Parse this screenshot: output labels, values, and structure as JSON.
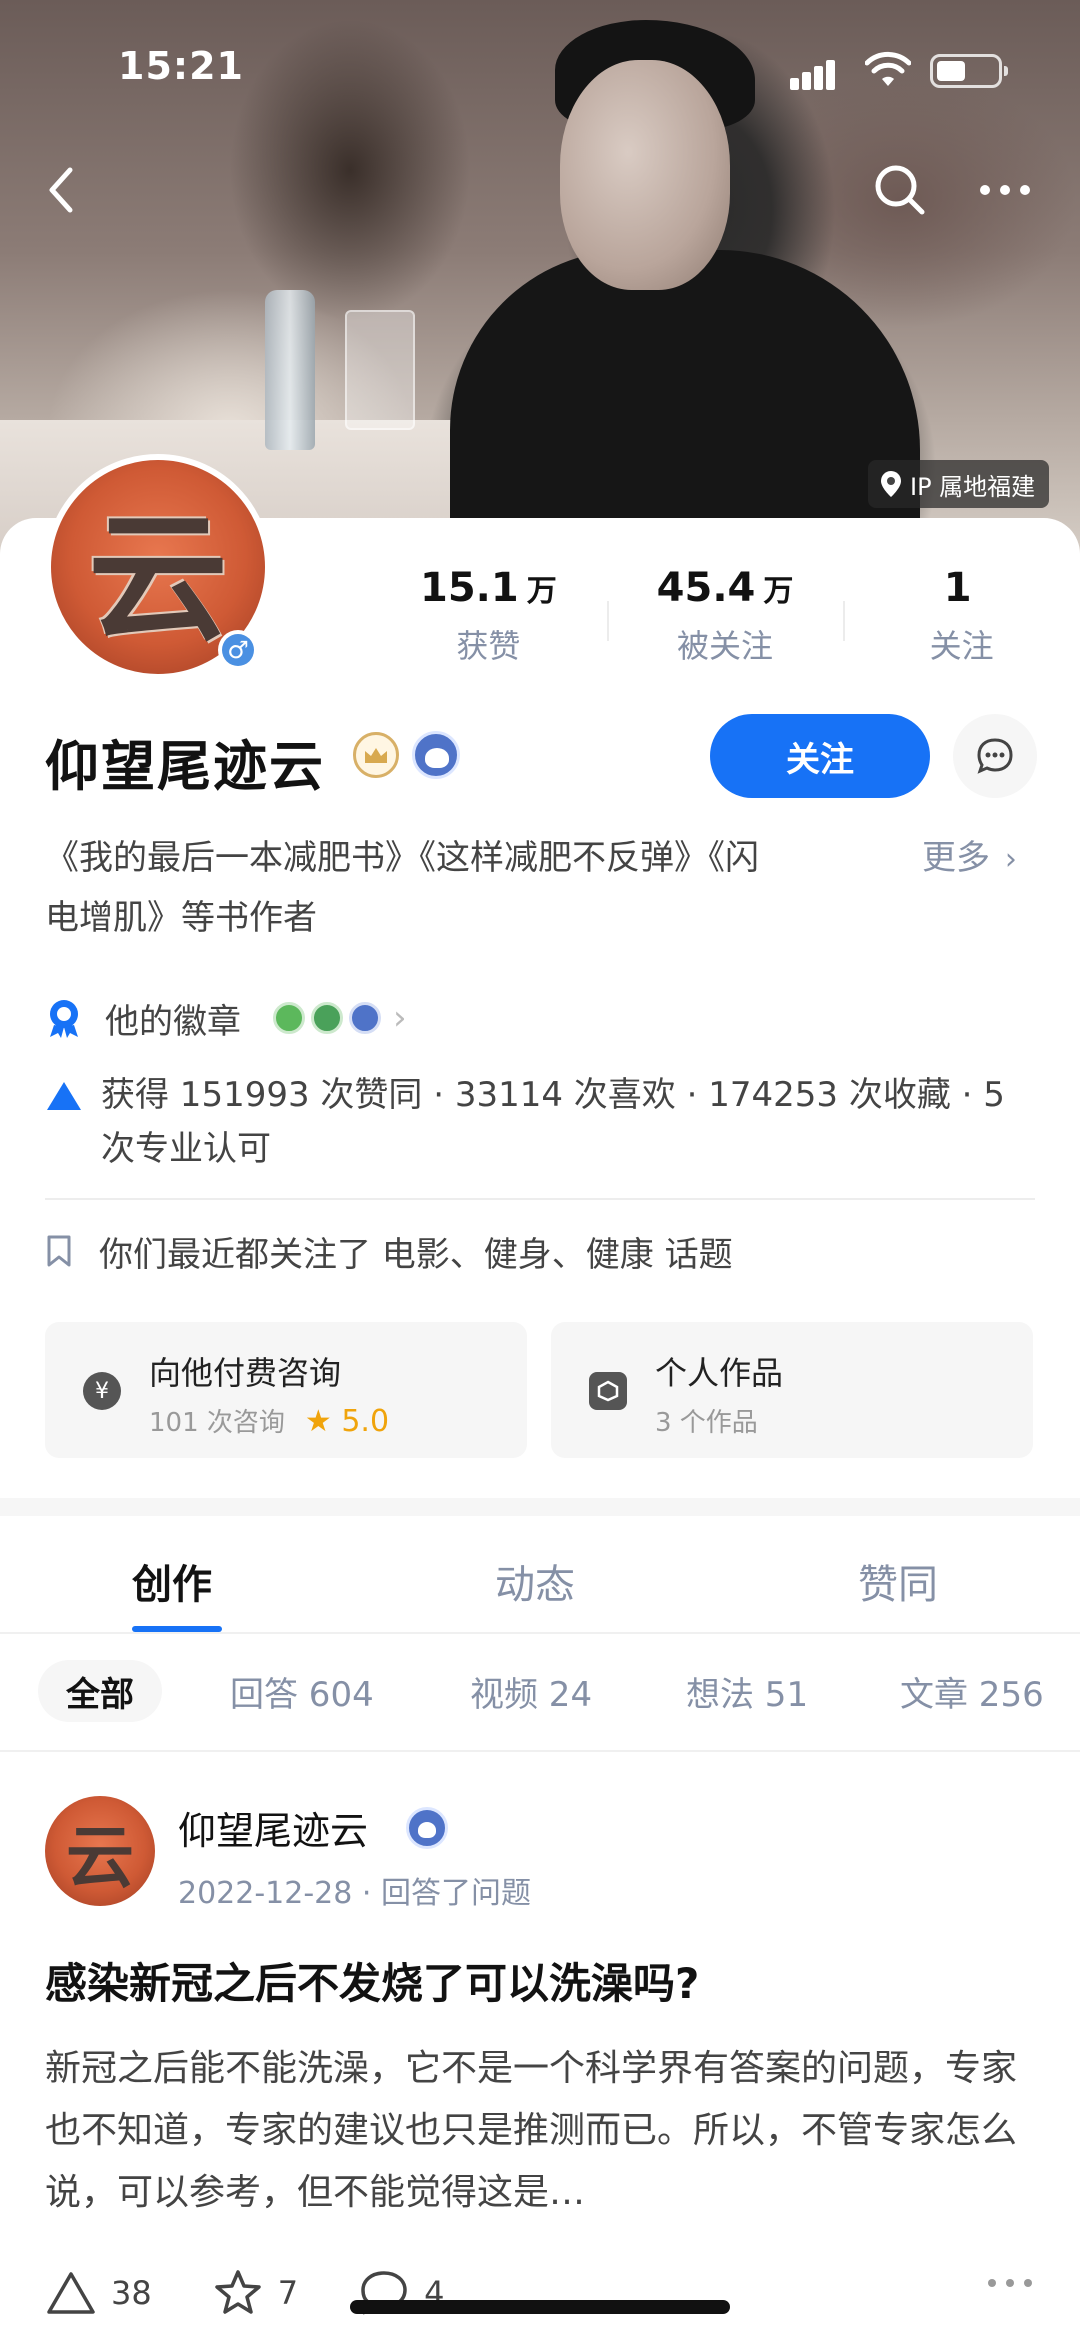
{
  "status_bar": {
    "time": "15:21"
  },
  "cover": {
    "ip_location": "IP 属地福建"
  },
  "profile": {
    "name": "仰望尾迹云",
    "avatar_glyph": "云",
    "gender_symbol": "♂",
    "stats": [
      {
        "value": "15.1",
        "unit": "万",
        "label": "获赞"
      },
      {
        "value": "45.4",
        "unit": "万",
        "label": "被关注"
      },
      {
        "value": "1",
        "unit": "",
        "label": "关注"
      }
    ],
    "follow_label": "关注",
    "bio": "《我的最后一本减肥书》《这样减肥不反弹》《闪电增肌》等书作者",
    "bio_more": "更多",
    "badges_label": "他的徽章",
    "achievements": "获得 151993 次赞同 · 33114 次喜欢 · 174253 次收藏 · 5 次专业认可",
    "common_topics": "你们最近都关注了 电影、健身、健康 话题"
  },
  "services": [
    {
      "title": "向他付费咨询",
      "sub": "101 次咨询",
      "rating": "★ 5.0",
      "icon": "yuan-icon"
    },
    {
      "title": "个人作品",
      "sub": "3 个作品",
      "rating": "",
      "icon": "works-icon"
    }
  ],
  "tabs": [
    "创作",
    "动态",
    "赞同"
  ],
  "filters": [
    "全部",
    "回答 604",
    "视频 24",
    "想法 51",
    "文章 256"
  ],
  "post": {
    "author": "仰望尾迹云",
    "meta": "2022-12-28 · 回答了问题",
    "title": "感染新冠之后不发烧了可以洗澡吗?",
    "excerpt": "新冠之后能不能洗澡，它不是一个科学界有答案的问题，专家也不知道，专家的建议也只是推测而已。所以，不管专家怎么说，可以参考，但不能觉得这是…",
    "upvotes": "38",
    "favorites": "7",
    "comments": "4"
  },
  "colors": {
    "accent": "#1772f6",
    "muted": "#8590a6",
    "rating": "#f0a40c"
  }
}
